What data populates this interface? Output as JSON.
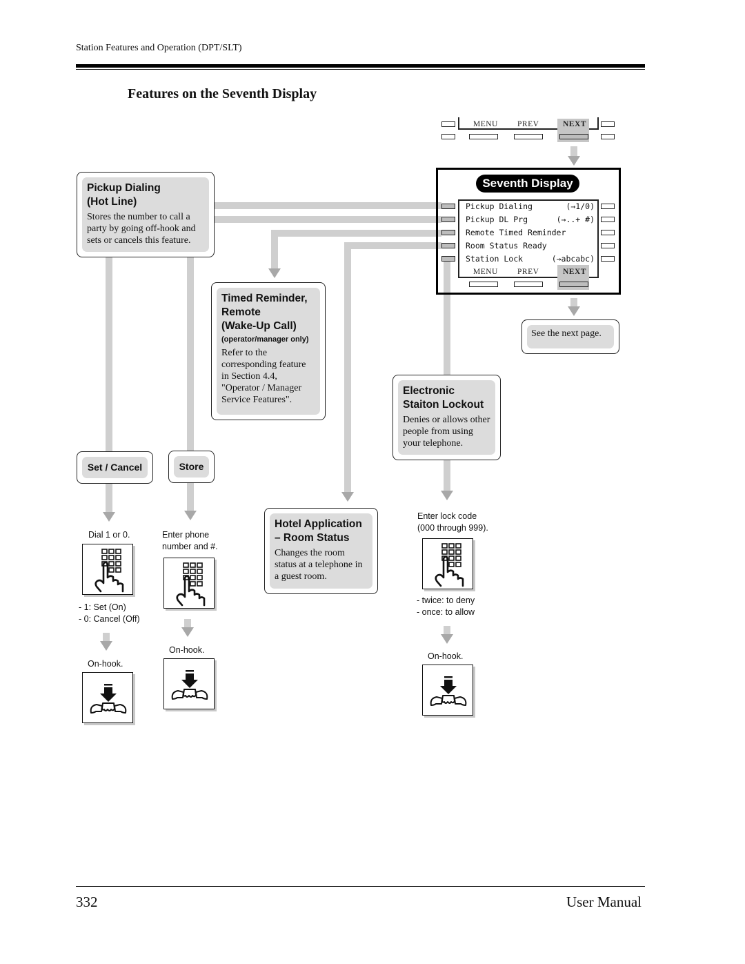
{
  "page": {
    "header": "Station Features and Operation (DPT/SLT)",
    "title": "Features on the Seventh Display",
    "page_number": "332",
    "footer_right": "User Manual"
  },
  "top_softkeys": {
    "menu": "MENU",
    "prev": "PREV",
    "next": "NEXT"
  },
  "display": {
    "title": "Seventh Display",
    "lines": [
      {
        "label": "Pickup Dialing",
        "hint": "(→1/0)"
      },
      {
        "label": "Pickup DL Prg",
        "hint": "(→..+ #)"
      },
      {
        "label": "Remote Timed Reminder",
        "hint": ""
      },
      {
        "label": "Room Status Ready",
        "hint": ""
      },
      {
        "label": "Station Lock",
        "hint": "(→abcabc)"
      }
    ],
    "softkeys": {
      "menu": "MENU",
      "prev": "PREV",
      "next": "NEXT"
    }
  },
  "see_next": "See the next page.",
  "features": {
    "pickup": {
      "title1": "Pickup Dialing",
      "title2": "(Hot Line)",
      "desc": "Stores the number to call a party by going off-hook and sets or cancels this feature.",
      "set_cancel_button": "Set / Cancel",
      "store_button": "Store",
      "set_caption": "Dial 1 or 0.",
      "set_options": [
        "- 1: Set (On)",
        "- 0: Cancel (Off)"
      ],
      "store_caption1": "Enter phone",
      "store_caption2": "number and #.",
      "onhook": "On-hook."
    },
    "timed": {
      "title1": "Timed Reminder,",
      "title2": "Remote",
      "title3": "(Wake-Up Call)",
      "sub": "(operator/manager only)",
      "desc": "Refer to the corresponding feature in Section 4.4, \"Operator / Manager Service Features\"."
    },
    "hotel": {
      "title1": "Hotel Application",
      "title2": "– Room Status",
      "desc": "Changes the room status at a telephone in a guest room."
    },
    "lock": {
      "title1": "Electronic",
      "title2": "Staiton Lockout",
      "desc": "Denies or allows other people from using your telephone.",
      "caption1": "Enter lock code",
      "caption2": "(000 through 999).",
      "options": [
        "- twice: to deny",
        "- once: to allow"
      ],
      "onhook": "On-hook."
    }
  },
  "icons": {
    "dial": "keypad-finger-icon",
    "onhook": "handset-on-hook-icon",
    "arrow": "down-arrow-icon"
  },
  "colors": {
    "flow": "#cfcfcf",
    "arrow": "#a8a8a8",
    "box_fill": "#dcdcdc",
    "highlight": "#c6c6c6"
  }
}
